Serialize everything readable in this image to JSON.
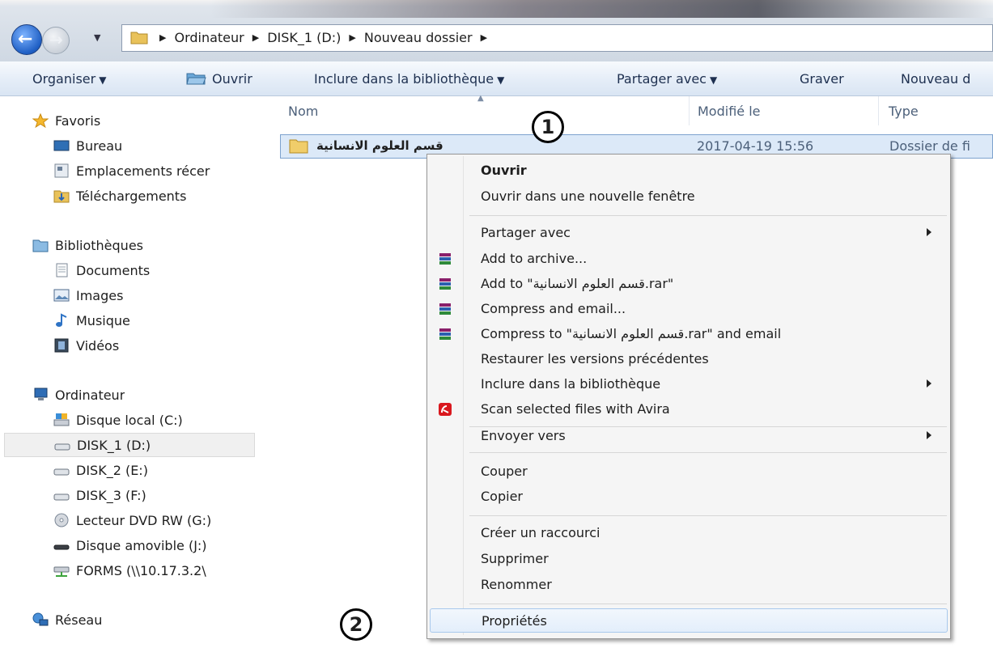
{
  "address": {
    "crumbs": [
      "Ordinateur",
      "DISK_1 (D:)",
      "Nouveau dossier"
    ]
  },
  "toolbar": {
    "organiser": "Organiser",
    "ouvrir": "Ouvrir",
    "inclure": "Inclure dans la bibliothèque",
    "partager": "Partager avec",
    "graver": "Graver",
    "nouveau": "Nouveau d"
  },
  "sidebar": {
    "favoris": "Favoris",
    "bureau": "Bureau",
    "emplacements": "Emplacements récer",
    "telechargements": "Téléchargements",
    "bibliotheques": "Bibliothèques",
    "documents": "Documents",
    "images": "Images",
    "musique": "Musique",
    "videos": "Vidéos",
    "ordinateur": "Ordinateur",
    "disque_c": "Disque local (C:)",
    "disk1": "DISK_1 (D:)",
    "disk2": "DISK_2 (E:)",
    "disk3": "DISK_3 (F:)",
    "dvd": "Lecteur DVD RW (G:)",
    "amovible": "Disque amovible (J:)",
    "forms": "FORMS (\\\\10.17.3.2\\",
    "reseau": "Réseau"
  },
  "columns": {
    "nom": "Nom",
    "modifie": "Modifié le",
    "type": "Type"
  },
  "file": {
    "name": "قسم العلوم الانسانية",
    "date": "2017-04-19 15:56",
    "type": "Dossier de fi"
  },
  "callouts": {
    "one": "1",
    "two": "2"
  },
  "context_menu": {
    "ouvrir": "Ouvrir",
    "ouvrir_nouvelle": "Ouvrir dans une nouvelle fenêtre",
    "partager": "Partager avec",
    "add_archive": "Add to archive...",
    "add_to_rar": "Add to \"قسم العلوم الانسانية.rar\"",
    "compress_email": "Compress and email...",
    "compress_to_email": "Compress to \"قسم العلوم الانسانية.rar\" and email",
    "restaurer": "Restaurer les versions précédentes",
    "inclure": "Inclure dans la bibliothèque",
    "avira": "Scan selected files with Avira",
    "envoyer": "Envoyer vers",
    "couper": "Couper",
    "copier": "Copier",
    "raccourci": "Créer un raccourci",
    "supprimer": "Supprimer",
    "renommer": "Renommer",
    "proprietes": "Propriétés"
  },
  "colors": {
    "selection": "#dce9f8",
    "selection_border": "#7da2ce",
    "menu_bg": "#f5f5f5",
    "avira_red": "#d9181e"
  }
}
